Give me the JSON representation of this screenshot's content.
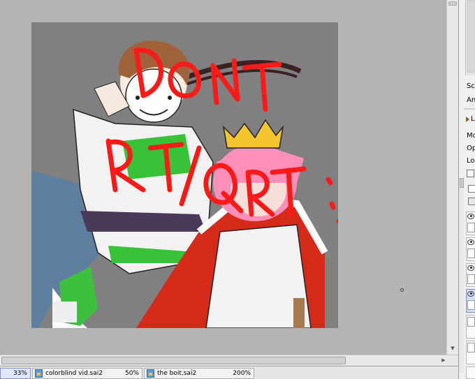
{
  "canvas": {
    "watermark": "DONT RT/QRT :)"
  },
  "side_panel": {
    "labels": {
      "scale": "Sca",
      "angle": "Ang",
      "layer_section": "L",
      "mode": "Mo",
      "opacity": "Op",
      "lock": "Loc"
    }
  },
  "doc_tabs": [
    {
      "name": "",
      "zoom": "33%",
      "active": true
    },
    {
      "name": "colorblind vid.sai2",
      "zoom": "50%",
      "active": false
    },
    {
      "name": "the boit.sai2",
      "zoom": "200%",
      "active": false
    }
  ],
  "colors": {
    "canvas_bg": "#808080",
    "workspace_bg": "#b4b4b4",
    "watermark": "#ff1a1a",
    "active_tab": "#dfe6ff"
  }
}
